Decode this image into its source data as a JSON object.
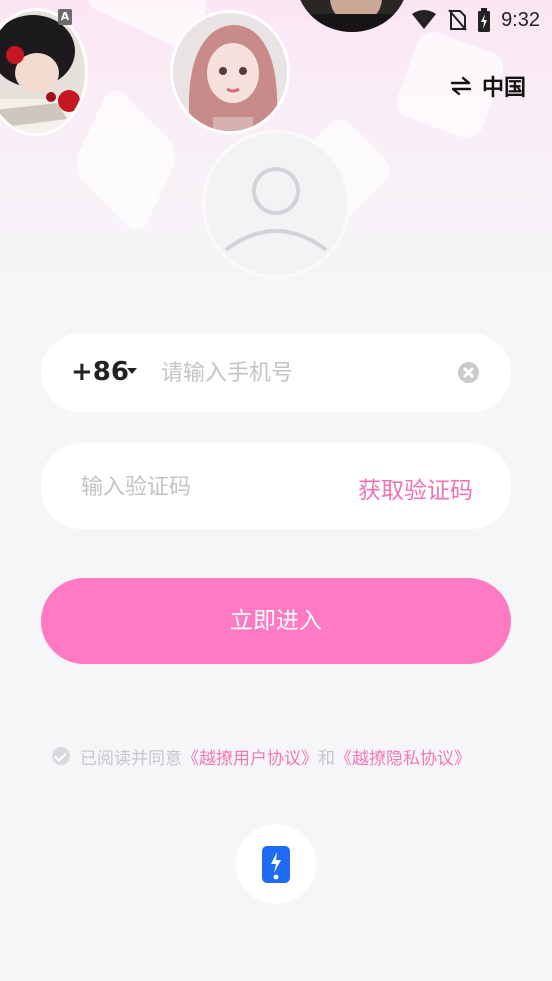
{
  "status_bar": {
    "time": "9:32",
    "notification_icon": "A"
  },
  "header": {
    "switch_icon": "swap-arrows-icon",
    "region_label": "中国"
  },
  "login": {
    "country_code": "+86",
    "phone_placeholder": "请输入手机号",
    "code_placeholder": "输入验证码",
    "get_code_label": "获取验证码",
    "submit_label": "立即进入"
  },
  "agreement": {
    "prefix": "已阅读并同意",
    "user_agreement": "《越撩用户协议》",
    "and": "和",
    "privacy_agreement": "《越撩隐私协议》",
    "checked": true
  },
  "quick_login": {
    "icon": "one-tap-phone-login-icon"
  },
  "colors": {
    "accent": "#ff7ac3",
    "link": "#f07ab6",
    "quick_login_icon": "#1f6bf2"
  }
}
